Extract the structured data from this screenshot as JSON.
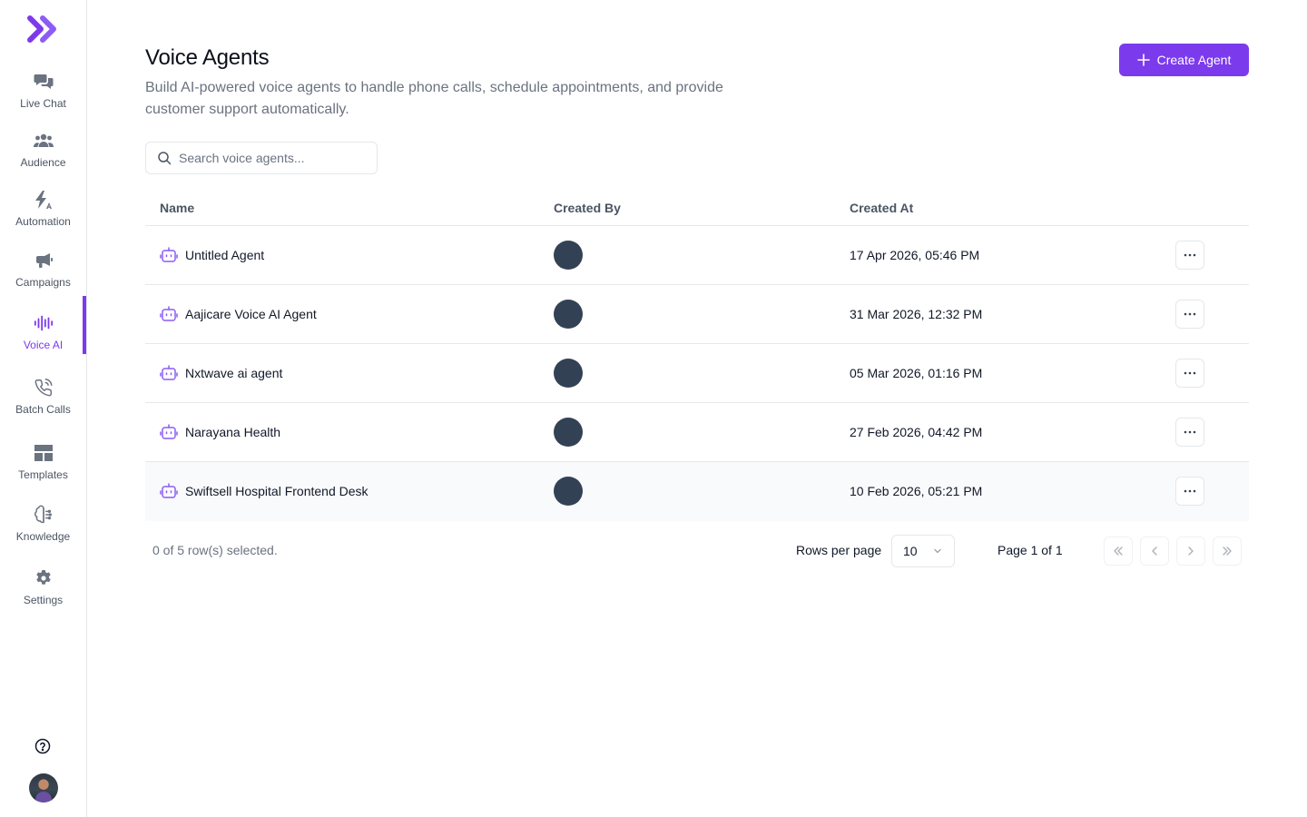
{
  "app": {
    "brand_color": "#7c3aed"
  },
  "sidebar": {
    "items": [
      {
        "label": "Live Chat",
        "icon": "chat-bubbles-icon"
      },
      {
        "label": "Audience",
        "icon": "users-icon"
      },
      {
        "label": "Automation",
        "icon": "bolt-icon"
      },
      {
        "label": "Campaigns",
        "icon": "megaphone-icon"
      },
      {
        "label": "Voice AI",
        "icon": "audio-wave-icon",
        "active": true
      },
      {
        "label": "Batch Calls",
        "icon": "phone-call-icon"
      },
      {
        "label": "Templates",
        "icon": "layout-template-icon"
      },
      {
        "label": "Knowledge",
        "icon": "brain-icon"
      },
      {
        "label": "Settings",
        "icon": "gear-icon"
      }
    ]
  },
  "header": {
    "title": "Voice Agents",
    "subtitle": "Build AI-powered voice agents to handle phone calls, schedule appointments, and provide customer support automatically.",
    "create_label": "Create Agent"
  },
  "search": {
    "placeholder": "Search voice agents..."
  },
  "table": {
    "columns": [
      "Name",
      "Created By",
      "Created At"
    ],
    "rows": [
      {
        "name": "Untitled Agent",
        "created_at": "17 Apr 2026, 05:46 PM"
      },
      {
        "name": "Aajicare Voice AI Agent",
        "created_at": "31 Mar 2026, 12:32 PM"
      },
      {
        "name": "Nxtwave ai agent",
        "created_at": "05 Mar 2026, 01:16 PM"
      },
      {
        "name": "Narayana Health",
        "created_at": "27 Feb 2026, 04:42 PM"
      },
      {
        "name": "Swiftsell Hospital Frontend Desk",
        "created_at": "10 Feb 2026, 05:21 PM"
      }
    ]
  },
  "footer": {
    "selected": "0 of 5 row(s) selected.",
    "rows_per_page_label": "Rows per page",
    "rows_per_page_value": "10",
    "page_info": "Page 1 of 1"
  }
}
